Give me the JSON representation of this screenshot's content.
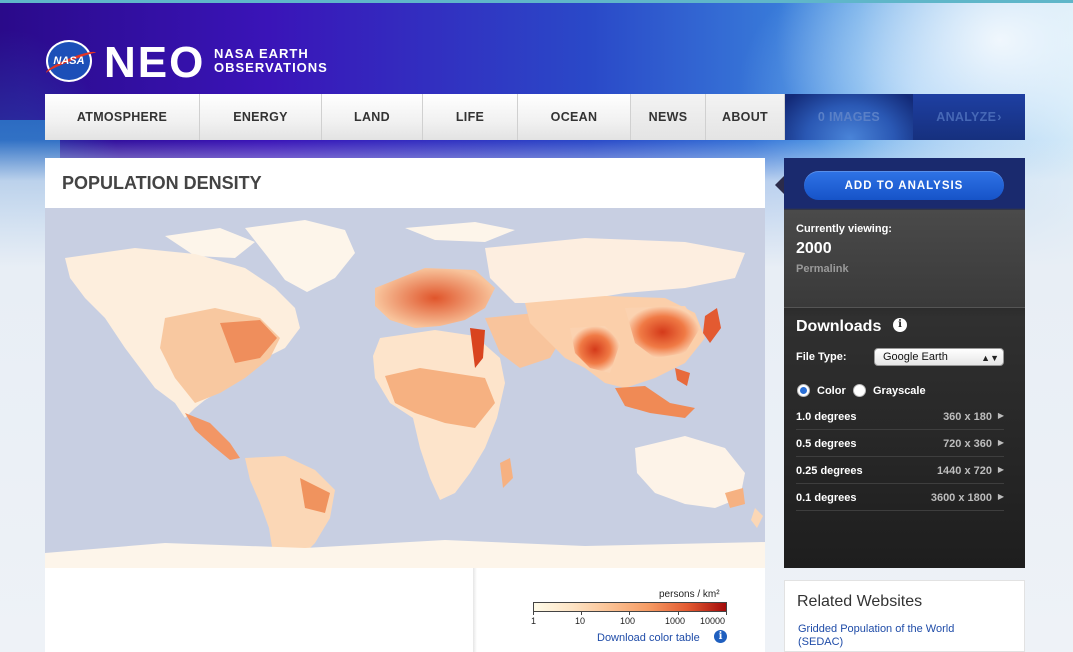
{
  "header": {
    "logo_text": "NASA",
    "title": "NEO",
    "subtitle_line1": "NASA EARTH",
    "subtitle_line2": "OBSERVATIONS"
  },
  "nav": {
    "items": [
      {
        "label": "ATMOSPHERE"
      },
      {
        "label": "ENERGY"
      },
      {
        "label": "LAND"
      },
      {
        "label": "LIFE"
      },
      {
        "label": "OCEAN"
      },
      {
        "label": "NEWS"
      },
      {
        "label": "ABOUT"
      },
      {
        "label": "0 IMAGES"
      },
      {
        "label": "ANALYZE"
      }
    ]
  },
  "main": {
    "title": "POPULATION DENSITY",
    "legend": {
      "unit": "persons / km²",
      "tick_labels": [
        "1",
        "10",
        "100",
        "1000",
        "10000"
      ],
      "colors": [
        "#fffbe8",
        "#fde3c4",
        "#fbc193",
        "#f59a63",
        "#e35a31",
        "#a30b0b"
      ]
    },
    "download_color_table": "Download color table"
  },
  "sidebar": {
    "add_button": "ADD TO ANALYSIS",
    "viewing_label": "Currently viewing:",
    "viewing_value": "2000",
    "permalink": "Permalink",
    "downloads_title": "Downloads",
    "file_type_label": "File Type:",
    "file_type_value": "Google Earth",
    "radio_color": "Color",
    "radio_grayscale": "Grayscale",
    "selected_mode": "Color",
    "resolutions": [
      {
        "degrees": "1.0 degrees",
        "size": "360 x 180"
      },
      {
        "degrees": "0.5 degrees",
        "size": "720 x 360"
      },
      {
        "degrees": "0.25 degrees",
        "size": "1440 x 720"
      },
      {
        "degrees": "0.1 degrees",
        "size": "3600 x 1800"
      }
    ]
  },
  "related": {
    "title": "Related Websites",
    "link": "Gridded Population of the World (SEDAC)"
  },
  "colors": {
    "ocean": "#c8cfe2",
    "land_low": "#fdf0e0",
    "land_mid": "#f7b48a",
    "land_high": "#d9441f",
    "link": "#1f4ca8",
    "button": "#1a5ad6"
  }
}
